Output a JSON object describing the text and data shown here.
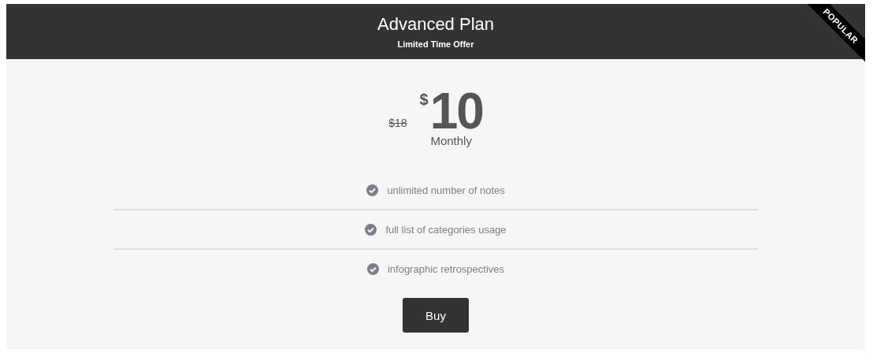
{
  "plan": {
    "title": "Advanced Plan",
    "subtitle": "Limited Time Offer",
    "ribbon": "POPULAR"
  },
  "price": {
    "old": "$18",
    "currency": "$",
    "amount": "10",
    "period": "Monthly"
  },
  "features": [
    {
      "text": "unlimited number of notes"
    },
    {
      "text": "full list of categories usage"
    },
    {
      "text": "infographic retrospectives"
    }
  ],
  "button": {
    "label": "Buy"
  }
}
